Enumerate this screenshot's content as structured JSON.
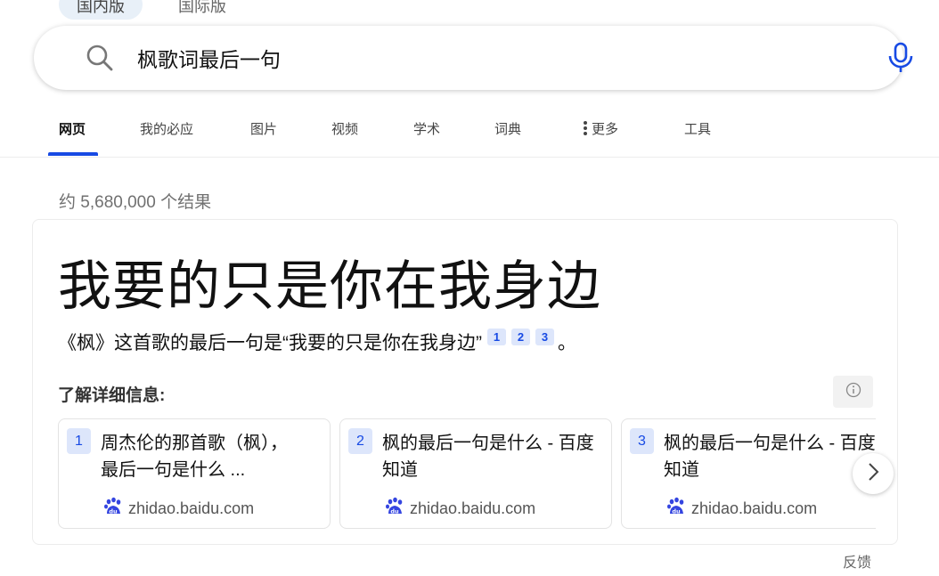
{
  "region_tabs": [
    {
      "label": "国内版",
      "active": true
    },
    {
      "label": "国际版",
      "active": false
    }
  ],
  "search": {
    "query": "枫歌词最后一句",
    "search_icon": "search-icon",
    "mic_icon": "microphone-icon"
  },
  "nav": {
    "items": [
      {
        "label": "网页",
        "active": true
      },
      {
        "label": "我的必应",
        "active": false
      },
      {
        "label": "图片",
        "active": false
      },
      {
        "label": "视频",
        "active": false
      },
      {
        "label": "学术",
        "active": false
      },
      {
        "label": "词典",
        "active": false
      },
      {
        "label": "更多",
        "active": false,
        "icon": "more-vertical-icon"
      },
      {
        "label": "工具",
        "active": false
      }
    ]
  },
  "result_count": "约 5,680,000 个结果",
  "answer": {
    "headline": "我要的只是你在我身边",
    "sentence": "《枫》这首歌的最后一句是“我要的只是你在我身边”",
    "citations": [
      "1",
      "2",
      "3"
    ],
    "sentence_end": "。",
    "learn_more_label": "了解详细信息:",
    "info_icon": "info-icon",
    "sources": [
      {
        "num": "1",
        "title": "周杰伦的那首歌（枫），\n最后一句是什么 ...",
        "site": "zhidao.baidu.com",
        "icon": "baidu-paw-icon"
      },
      {
        "num": "2",
        "title": "枫的最后一句是什么 - 百度\n知道",
        "site": "zhidao.baidu.com",
        "icon": "baidu-paw-icon"
      },
      {
        "num": "3",
        "title": "枫的最后一句是什么 - 百度\n知道",
        "site": "zhidao.baidu.com",
        "icon": "baidu-paw-icon"
      }
    ],
    "next_icon": "chevron-right-icon"
  },
  "feedback_label": "反馈",
  "colors": {
    "accent": "#174ae4",
    "badge_bg": "#dde6fb",
    "baidu": "#3445e0"
  }
}
